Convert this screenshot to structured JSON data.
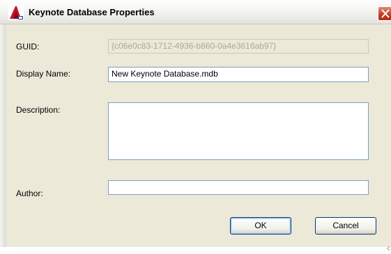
{
  "window": {
    "title": "Keynote Database Properties"
  },
  "form": {
    "guid_label": "GUID:",
    "guid_value": "{c06e0c83-1712-4936-b860-0a4e3616ab97}",
    "display_name_label": "Display Name:",
    "display_name_value": "New Keynote Database.mdb",
    "description_label": "Description:",
    "description_value": "",
    "author_label": "Author:",
    "author_value": ""
  },
  "buttons": {
    "ok_label": "OK",
    "cancel_label": "Cancel"
  },
  "icons": {
    "app": "autocad-architecture-icon",
    "close": "close-icon"
  },
  "colors": {
    "dialog_background": "#ece9d8",
    "field_border": "#7f9db9",
    "close_button": "#c43a22"
  }
}
